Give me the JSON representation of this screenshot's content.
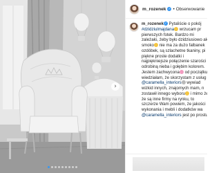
{
  "post": {
    "username": "m_rozenek",
    "separator": "•",
    "follow_label": "Obserwowanie",
    "verified_icon": "verified-badge-icon",
    "next_icon": "chevron-right-icon",
    "carousel": {
      "count": 9,
      "active_index": 0,
      "active_color": "#3897f0"
    }
  },
  "caption": {
    "lines": [
      {
        "user": "m_rozenek",
        "text": " Pytaliście o pokój"
      },
      {
        "tag": "#dzidziulmajdana",
        "emoji": "yellow",
        "text": " wrzucam pr"
      },
      {
        "text": "pierwszych fotek. Bardzo mi"
      },
      {
        "text": "zależało, żeby było dzidziusiowo ale"
      },
      {
        "text": "smoko",
        "emoji": "yellow",
        "after": " nie ma za dużo falbanek"
      },
      {
        "text": "ozdóbek, są szlachetne tkaniny, pi"
      },
      {
        "text": "piękne proste dodatki i"
      },
      {
        "text": "najpiękniejsze połączenie szarości"
      },
      {
        "text": "odrobiną nieba i gołębim kolorem."
      },
      {
        "text": "Jestem zachwycona",
        "emoji": "pink",
        "after": " od początku"
      },
      {
        "text": "wiedziałam, że skorzystam z usług"
      },
      {
        "tag": "@caramella_interiors",
        "emoji": "grey",
        "after": " wywiad"
      },
      {
        "text": "wizkid innych, znajomych mam, n"
      },
      {
        "text": "zostawił innego wyboru",
        "emoji": "yellow",
        "after": " i mimo że"
      },
      {
        "text": "że są inne firmy na rynku, to"
      },
      {
        "text": "szczerze Wam powiem, że jakości"
      },
      {
        "text": "wykonania i mebli i dodatków wa"
      },
      {
        "tag": "@caramella_interiors",
        "after": " jest po prostu"
      }
    ]
  },
  "colors": {
    "tag": "#003569",
    "text": "#262626",
    "verified": "#3897f0"
  }
}
